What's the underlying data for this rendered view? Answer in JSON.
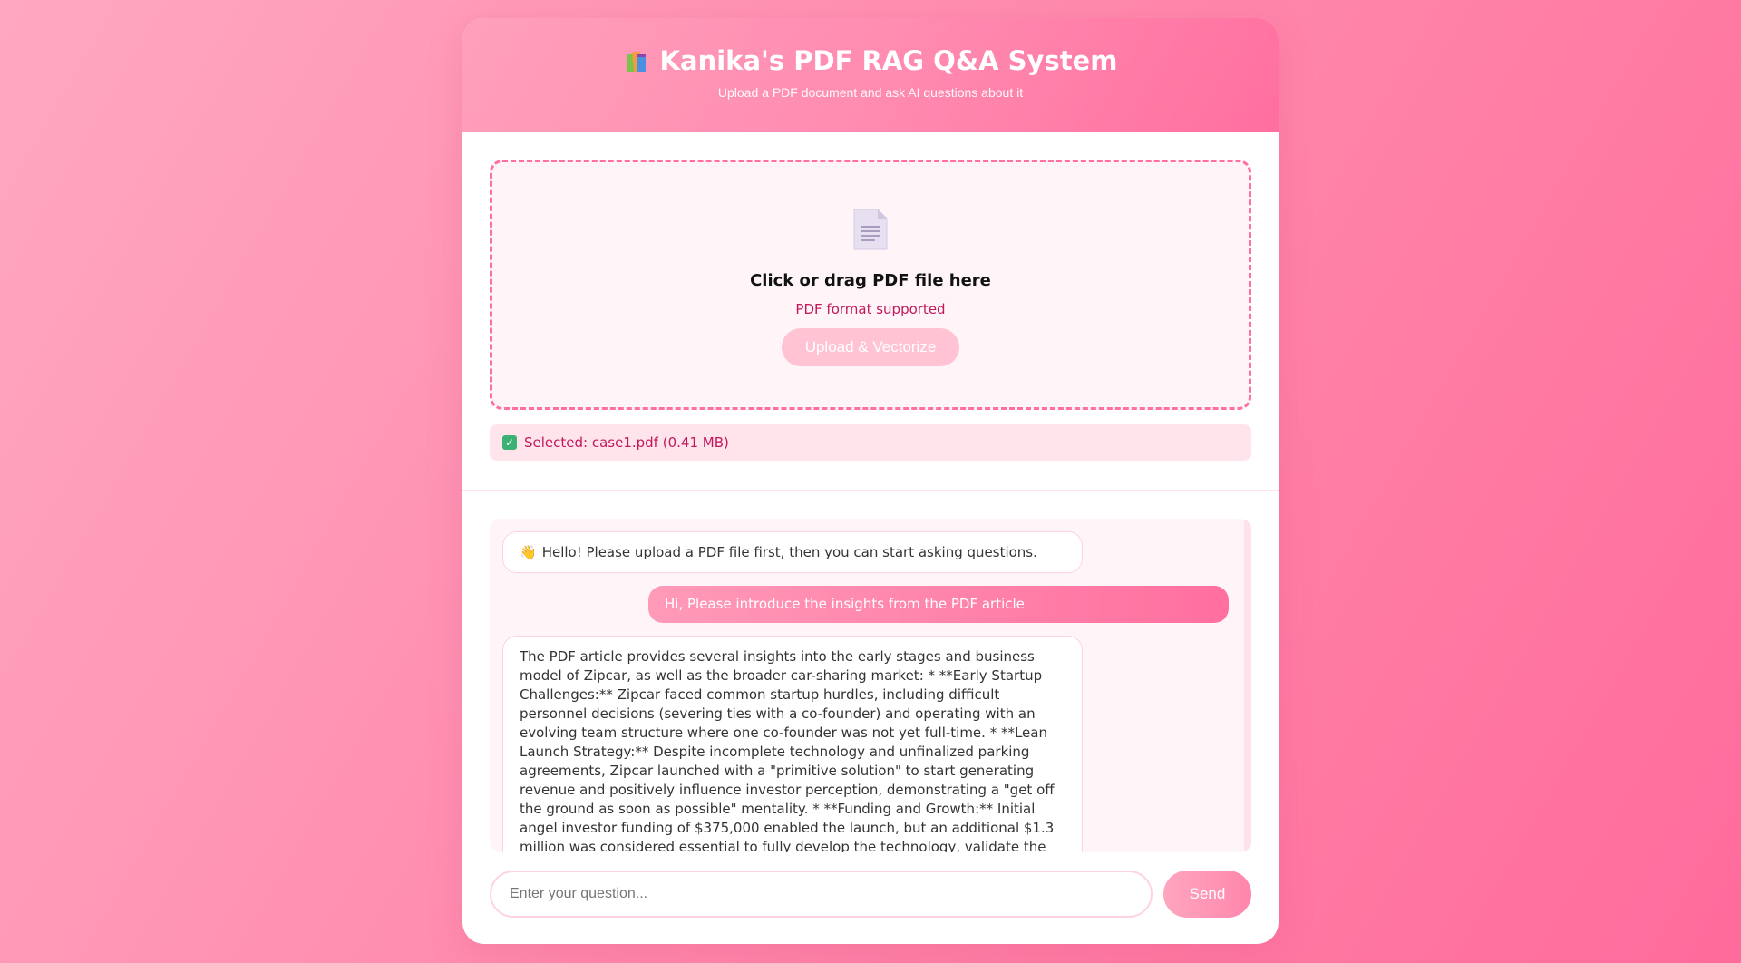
{
  "header": {
    "title": "Kanika's PDF RAG Q&A System",
    "subtitle": "Upload a PDF document and ask AI questions about it",
    "icon": "books-icon"
  },
  "upload": {
    "drop_title": "Click or drag PDF file here",
    "drop_hint": "PDF format supported",
    "upload_button": "Upload & Vectorize",
    "selected_text": "Selected: case1.pdf (0.41 MB)",
    "icon": "file-icon"
  },
  "chat": {
    "messages": [
      {
        "role": "bot",
        "text": "Hello! Please upload a PDF file first, then you can start asking questions."
      },
      {
        "role": "user",
        "text": "Hi, Please introduce the insights from the PDF article"
      },
      {
        "role": "bot",
        "text": "The PDF article provides several insights into the early stages and business model of Zipcar, as well as the broader car-sharing market: * **Early Startup Challenges:** Zipcar faced common startup hurdles, including difficult personnel decisions (severing ties with a co-founder) and operating with an evolving team structure where one co-founder was not yet full-time. * **Lean Launch Strategy:** Despite incomplete technology and unfinalized parking agreements, Zipcar launched with a \"primitive solution\" to start generating revenue and positively influence investor perception, demonstrating a \"get off the ground as soon as possible\" mentality. * **Funding and Growth:** Initial angel investor funding of $375,000 enabled the launch, but an additional $1.3 million was considered essential to fully develop the technology, validate the business model in Boston, and better understand market"
      }
    ]
  },
  "input": {
    "placeholder": "Enter your question...",
    "send_button": "Send"
  },
  "colors": {
    "accent": "#ff6f9f",
    "hint_text": "#c2185b",
    "check": "#3bb273"
  }
}
